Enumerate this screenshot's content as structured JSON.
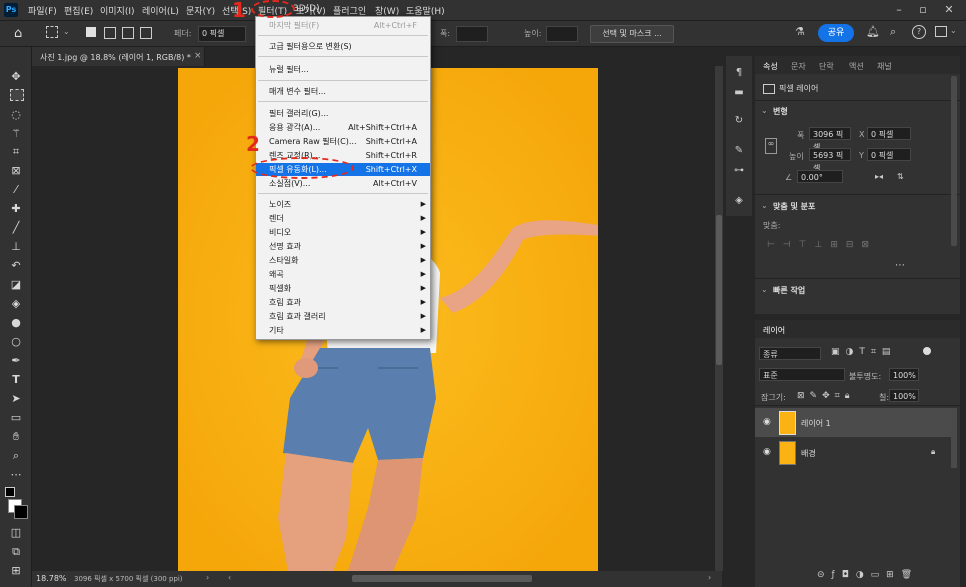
{
  "app": {
    "logo": "Ps"
  },
  "menubar": {
    "items": [
      "파일(F)",
      "편집(E)",
      "이미지(I)",
      "레이어(L)",
      "문자(Y)",
      "선택(S)",
      "필터(T)",
      "3D(D)",
      "보기(V)",
      "플러그인",
      "창(W)",
      "도움말(H)"
    ]
  },
  "optionsbar": {
    "feather_label": "페더:",
    "feather_value": "0 픽셀",
    "width_label": "폭:",
    "height_label": "높이:",
    "select_mask_button": "선택 및 마스크 ...",
    "share_button": "공유"
  },
  "document": {
    "tab_title": "사진 1.jpg @ 18.8% (레이어 1, RGB/8) *",
    "close": "×"
  },
  "status": {
    "zoom": "18.78%",
    "info": "3096 픽셀 x 5700 픽셀 (300 ppi)"
  },
  "filter_menu": {
    "items": [
      {
        "label": "마지막 필터(F)",
        "shortcut": "Alt+Ctrl+F",
        "disabled": true
      },
      {
        "label": "고급 필터용으로 변환(S)",
        "shortcut": ""
      },
      {
        "label": "뉴럴 필터...",
        "shortcut": ""
      },
      {
        "label": "매개 변수 필터...",
        "shortcut": ""
      },
      {
        "label": "필터 갤러리(G)...",
        "shortcut": ""
      },
      {
        "label": "응용 광각(A)...",
        "shortcut": "Alt+Shift+Ctrl+A"
      },
      {
        "label": "Camera Raw 필터(C)...",
        "shortcut": "Shift+Ctrl+A"
      },
      {
        "label": "렌즈 교정(R)...",
        "shortcut": "Shift+Ctrl+R"
      },
      {
        "label": "픽셀 유동화(L)...",
        "shortcut": "Shift+Ctrl+X",
        "highlighted": true
      },
      {
        "label": "소실점(V)...",
        "shortcut": "Alt+Ctrl+V"
      },
      {
        "label": "노이즈",
        "submenu": true
      },
      {
        "label": "렌더",
        "submenu": true
      },
      {
        "label": "비디오",
        "submenu": true
      },
      {
        "label": "선명 효과",
        "submenu": true
      },
      {
        "label": "스타일화",
        "submenu": true
      },
      {
        "label": "왜곡",
        "submenu": true
      },
      {
        "label": "픽셀화",
        "submenu": true
      },
      {
        "label": "흐림 효과",
        "submenu": true
      },
      {
        "label": "흐림 효과 갤러리",
        "submenu": true
      },
      {
        "label": "기타",
        "submenu": true
      }
    ]
  },
  "annotations": {
    "step1": "1",
    "step2": "2"
  },
  "properties": {
    "tabs": [
      "속성",
      "문자",
      "단락",
      "액션",
      "채널"
    ],
    "layer_type": "픽셀 레이어",
    "transform_header": "변형",
    "w_label": "폭",
    "w_value": "3096 픽셀",
    "h_label": "높이",
    "h_value": "5693 픽셀",
    "x_label": "X",
    "x_value": "0 픽셀",
    "y_label": "Y",
    "y_value": "0 픽셀",
    "angle_value": "0.00°",
    "align_header": "맞춤 및 분포",
    "align_label": "맞춤:",
    "quick_actions_header": "빠른 작업"
  },
  "layers": {
    "title": "레이어",
    "kind_filter": "종류",
    "blend_mode": "표준",
    "opacity_label": "불투명도:",
    "opacity_value": "100%",
    "lock_label": "잠그기:",
    "fill_label": "칠:",
    "fill_value": "100%",
    "items": [
      {
        "name": "레이어 1",
        "selected": true
      },
      {
        "name": "배경",
        "locked": true
      }
    ]
  },
  "colors": {
    "accent": "#1473e6",
    "photo_bg": "#fbb313",
    "annotation": "#e5281c"
  }
}
